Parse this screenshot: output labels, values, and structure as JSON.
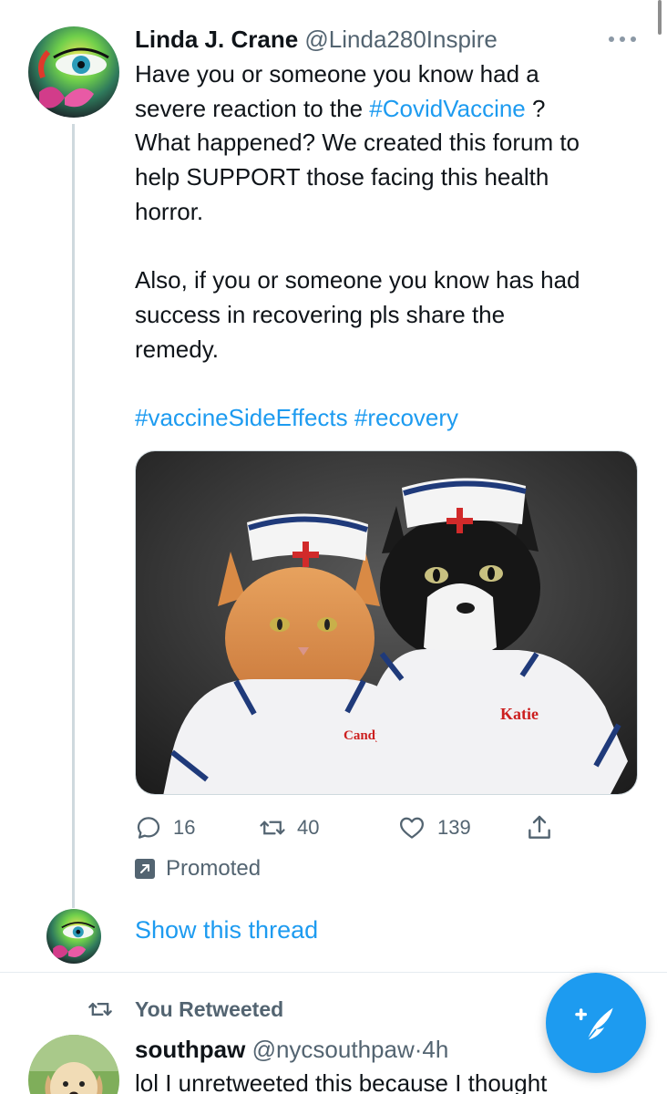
{
  "tweet": {
    "display_name": "Linda J. Crane",
    "handle": "@Linda280Inspire",
    "text_line1_a": "Have you or someone you know had a",
    "text_line2_a": "severe reaction to the ",
    "text_line2_hashtag": "#CovidVaccine",
    "text_line2_b": " ?",
    "text_line3": "What happened? We created this forum to",
    "text_line4": "help SUPPORT those facing this health",
    "text_line5": "horror.",
    "text_para2_line1": "Also, if you or someone you know has had",
    "text_para2_line2": "success  in recovering pls share the",
    "text_para2_line3": "remedy.",
    "hashtags": "#vaccineSideEffects #recovery",
    "media": {
      "label_left": "Candy",
      "label_right": "Katie"
    },
    "stats": {
      "replies": "16",
      "retweets": "40",
      "likes": "139"
    },
    "promoted_label": "Promoted",
    "show_thread_label": "Show this thread"
  },
  "retweet_context": {
    "label": "You Retweeted"
  },
  "tweet2": {
    "display_name": "southpaw",
    "handle": "@nycsouthpaw",
    "separator": "·",
    "time": "4h",
    "text": "lol I unretweeted this because I thought"
  },
  "icons": {
    "more": "more-horizontal-icon",
    "reply": "reply-icon",
    "retweet": "retweet-icon",
    "like": "heart-icon",
    "share": "share-icon",
    "promoted": "promoted-arrow-icon",
    "compose": "compose-tweet-icon"
  },
  "colors": {
    "accent": "#1d9bf0",
    "secondary_text": "#536471",
    "primary_text": "#0f1419"
  }
}
